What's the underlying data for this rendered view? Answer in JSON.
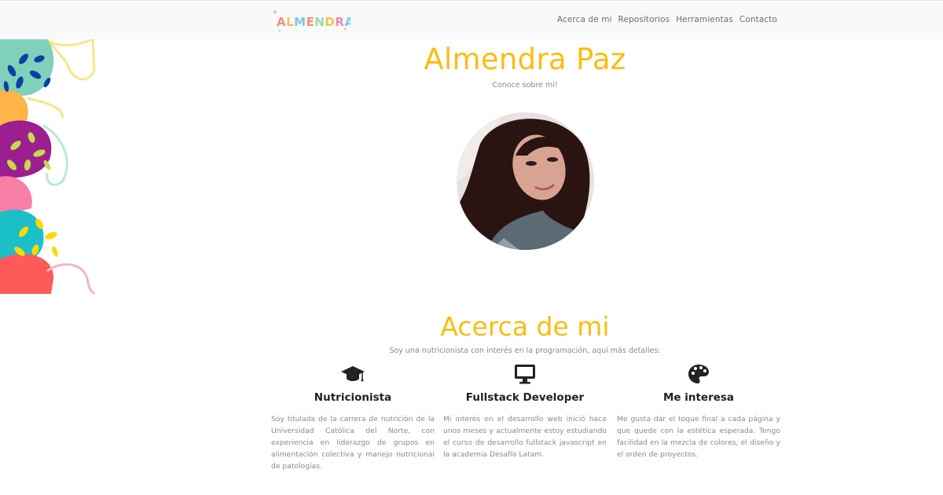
{
  "nav": {
    "brand": "ALMENDRA",
    "links": [
      "Acerca de mi",
      "Repositorios",
      "Herramientas",
      "Contacto"
    ]
  },
  "hero": {
    "title": "Almendra Paz",
    "subtitle": "Conoce sobre mi!"
  },
  "about": {
    "title": "Acerca de mi",
    "subtitle": "Soy una nutricionista con interés en la programación, aquí más detalles:",
    "columns": [
      {
        "icon": "graduation-cap-icon",
        "title": "Nutricionista",
        "text": "Soy titulada de la carrera de nutrición de la Universidad Católica del Norte, con experiencia en liderazgo de grupos en alimentación colectiva y manejo nutricional de patologías."
      },
      {
        "icon": "desktop-icon",
        "title": "Fullstack Developer",
        "text": "Mi interés en el desarrollo web inició hace unos meses y actualmente estoy estudiando el curso de desarrollo fullstack javascript en la academia Desafío Latam."
      },
      {
        "icon": "palette-icon",
        "title": "Me interesa",
        "text": "Me gusta dar el toque final a cada página y que quede con la estética esperada. Tengo facilidad en la mezcla de colores, el diseño y el orden de proyectos."
      }
    ]
  },
  "colors": {
    "accent": "#fbbd13",
    "nav_bg": "#f8f9fa",
    "muted_text": "#8a8a8a"
  }
}
